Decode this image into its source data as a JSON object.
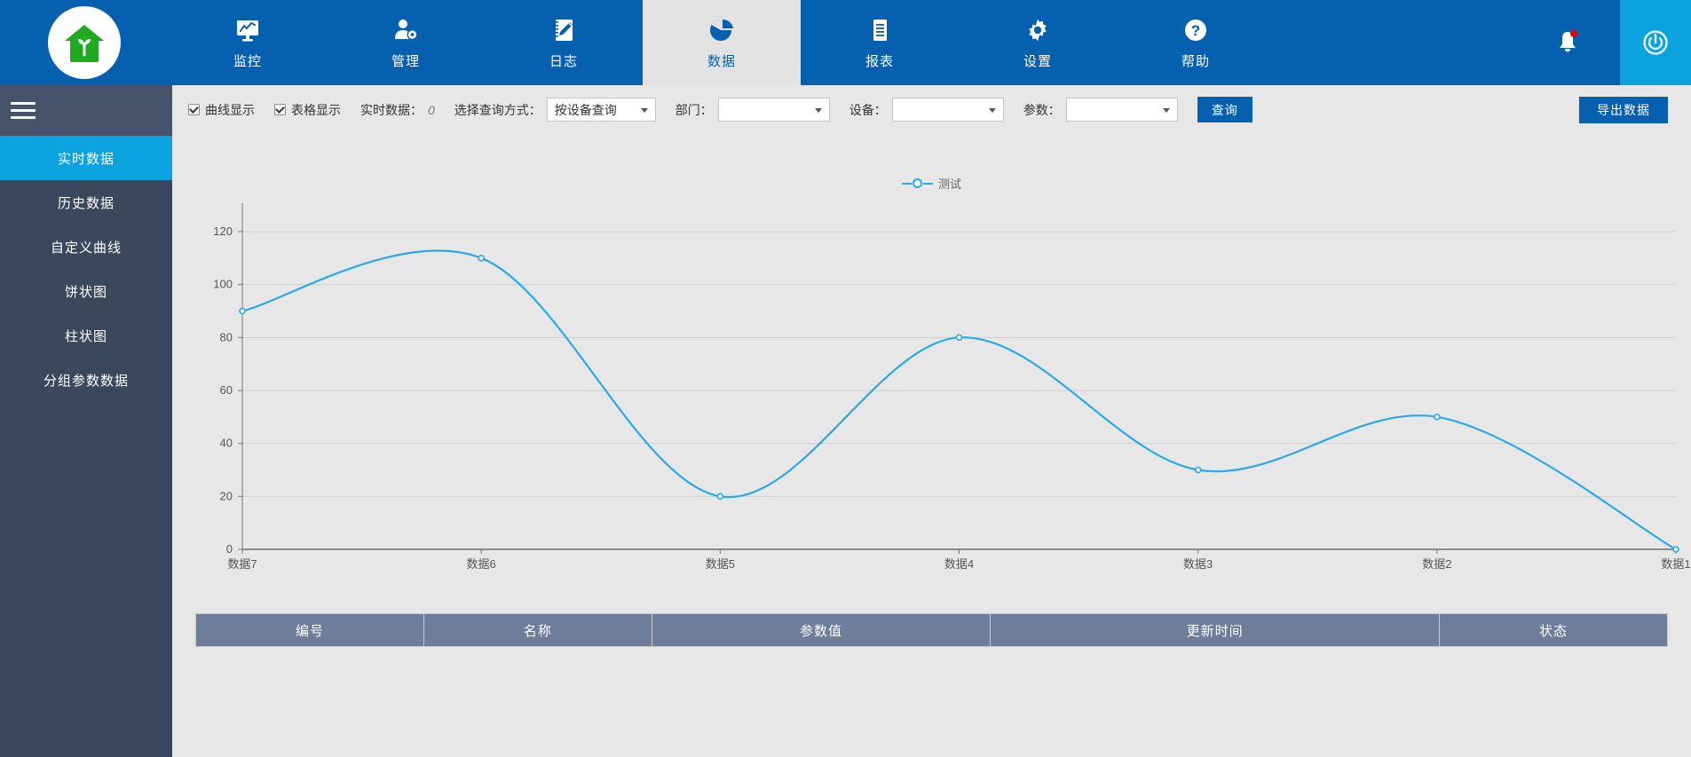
{
  "topnav": {
    "logo_icon": "green-house-sprout-logo",
    "items": [
      {
        "label": "监控",
        "icon": "monitor-chart-icon",
        "active": false
      },
      {
        "label": "管理",
        "icon": "user-gear-icon",
        "active": false
      },
      {
        "label": "日志",
        "icon": "notebook-pen-icon",
        "active": false
      },
      {
        "label": "数据",
        "icon": "pie-chart-icon",
        "active": true
      },
      {
        "label": "报表",
        "icon": "document-lines-icon",
        "active": false
      },
      {
        "label": "设置",
        "icon": "gear-icon",
        "active": false
      },
      {
        "label": "帮助",
        "icon": "question-circle-icon",
        "active": false
      }
    ],
    "bell_icon": "bell-notification-icon",
    "power_icon": "power-icon",
    "bar_color": "#0560b0",
    "power_bg_color": "#0aa3e0",
    "badge_color": "#e60000"
  },
  "sidebar": {
    "menu_icon": "hamburger-menu-icon",
    "bg_color": "#3b475c",
    "active_color": "#0aa3e0",
    "items": [
      {
        "label": "实时数据",
        "active": true
      },
      {
        "label": "历史数据",
        "active": false
      },
      {
        "label": "自定义曲线",
        "active": false
      },
      {
        "label": "饼状图",
        "active": false
      },
      {
        "label": "柱状图",
        "active": false
      },
      {
        "label": "分组参数数据",
        "active": false
      }
    ]
  },
  "toolbar": {
    "curve_display_label": "曲线显示",
    "curve_display_checked": true,
    "table_display_label": "表格显示",
    "table_display_checked": true,
    "realtime_label": "实时数据：",
    "realtime_value": "0",
    "query_mode_label": "选择查询方式：",
    "query_mode_value": "按设备查询",
    "dept_label": "部门：",
    "dept_value": "",
    "device_label": "设备：",
    "device_value": "",
    "param_label": "参数：",
    "param_value": "",
    "query_button": "查询",
    "export_button": "导出数据",
    "accent_color": "#0560b0"
  },
  "chart_data": {
    "type": "line",
    "title": "",
    "categories": [
      "数据7",
      "数据6",
      "数据5",
      "数据4",
      "数据3",
      "数据2",
      "数据1"
    ],
    "series": [
      {
        "name": "测试",
        "values": [
          90,
          110,
          20,
          80,
          30,
          50,
          0
        ],
        "color": "#28a9e8"
      }
    ],
    "legend": [
      "测试"
    ],
    "legend_position": "top-center",
    "xlabel": "",
    "ylabel": "",
    "ylim": [
      0,
      120
    ],
    "yticks": [
      0,
      20,
      40,
      60,
      80,
      100,
      120
    ],
    "grid": true,
    "smooth": true,
    "background_color": "#e7e7e7"
  },
  "table": {
    "headers": [
      "编号",
      "名称",
      "参数值",
      "更新时间",
      "状态"
    ],
    "rows": [],
    "header_bg_color": "#6e7d99"
  }
}
